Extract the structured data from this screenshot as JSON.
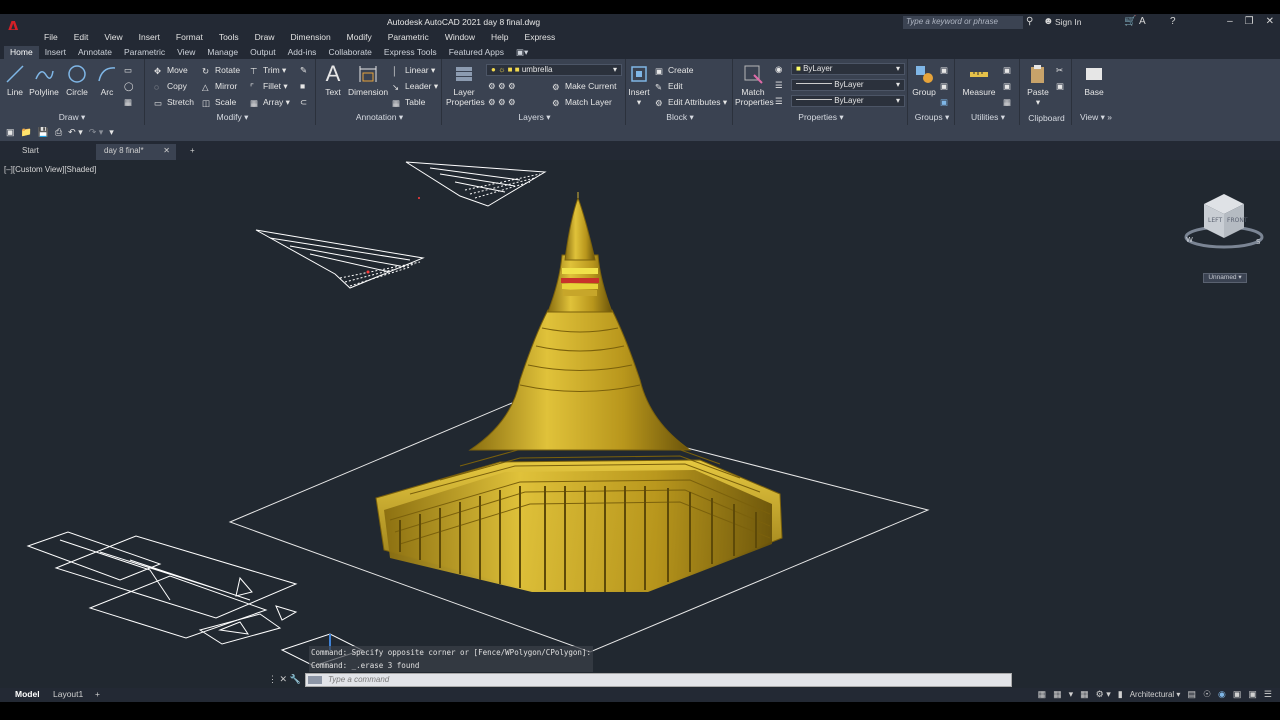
{
  "window": {
    "title": "Autodesk AutoCAD 2021    day 8 final.dwg",
    "logo": "A",
    "search_placeholder": "Type a keyword or phrase",
    "sign_in": "Sign In"
  },
  "menu": [
    "File",
    "Edit",
    "View",
    "Insert",
    "Format",
    "Tools",
    "Draw",
    "Dimension",
    "Modify",
    "Parametric",
    "Window",
    "Help",
    "Express"
  ],
  "ribbon_tabs": [
    "Home",
    "Insert",
    "Annotate",
    "Parametric",
    "View",
    "Manage",
    "Output",
    "Add-ins",
    "Collaborate",
    "Express Tools",
    "Featured Apps"
  ],
  "draw": {
    "title": "Draw",
    "line": "Line",
    "polyline": "Polyline",
    "circle": "Circle",
    "arc": "Arc"
  },
  "modify": {
    "title": "Modify",
    "move": "Move",
    "rotate": "Rotate",
    "trim": "Trim",
    "copy": "Copy",
    "mirror": "Mirror",
    "fillet": "Fillet",
    "stretch": "Stretch",
    "scale": "Scale",
    "array": "Array"
  },
  "annotation": {
    "title": "Annotation",
    "text": "Text",
    "dimension": "Dimension",
    "linear": "Linear",
    "leader": "Leader",
    "table": "Table"
  },
  "layers": {
    "title": "Layers",
    "layer_properties_1": "Layer",
    "layer_properties_2": "Properties",
    "current_layer": "umbrella",
    "make_current": "Make Current",
    "match_layer": "Match Layer"
  },
  "block": {
    "title": "Block",
    "insert": "Insert",
    "create": "Create",
    "edit": "Edit",
    "edit_attributes": "Edit Attributes"
  },
  "properties": {
    "title": "Properties",
    "match_1": "Match",
    "match_2": "Properties",
    "color": "ByLayer",
    "linetype": "ByLayer",
    "lineweight": "ByLayer"
  },
  "groups": {
    "title": "Groups",
    "group": "Group"
  },
  "utilities": {
    "title": "Utilities",
    "measure": "Measure"
  },
  "clipboard": {
    "title": "Clipboard",
    "paste": "Paste"
  },
  "view_panel": {
    "title": "View",
    "base": "Base"
  },
  "doc_tabs": {
    "start": "Start",
    "active": "day 8 final*"
  },
  "viewport": {
    "label": "[–][Custom View][Shaded]",
    "viewcube_left": "LEFT",
    "viewcube_front": "FRONT",
    "viewcube_w": "W",
    "viewcube_s": "S",
    "ucs_name": "Unnamed"
  },
  "command": {
    "history": [
      "Command: Specify opposite corner or [Fence/WPolygon/CPolygon]:",
      "Command: _.erase 3 found"
    ],
    "placeholder": "Type a command"
  },
  "status": {
    "model": "Model",
    "layout1": "Layout1",
    "units": "Architectural"
  },
  "colors": {
    "accent": "#d32027",
    "viewport_bg": "#212830",
    "ribbon_bg": "#3a4251",
    "gold": "#c9a521"
  }
}
